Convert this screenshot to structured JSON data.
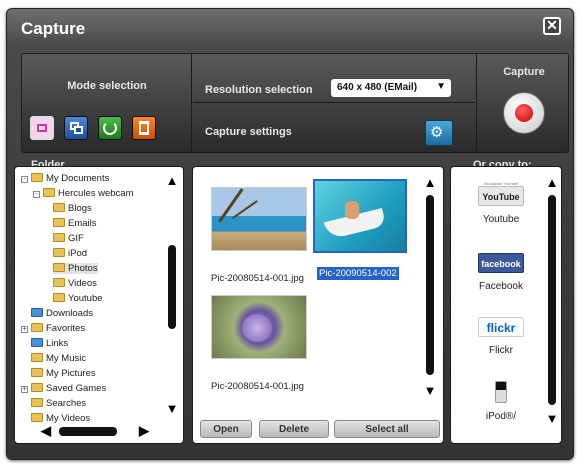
{
  "window": {
    "title": "Capture",
    "close_symbol": "✕"
  },
  "mode_selection": {
    "label": "Mode selection"
  },
  "resolution": {
    "label": "Resolution selection",
    "selected": "640 x 480 (EMail)"
  },
  "capture_settings": {
    "label": "Capture settings"
  },
  "capture": {
    "label": "Capture"
  },
  "folder": {
    "label": "Folder",
    "tree": [
      "My Documents",
      "Hercules webcam",
      "Blogs",
      "Emails",
      "GIF",
      "iPod",
      "Photos",
      "Videos",
      "Youtube",
      "Downloads",
      "Favorites",
      "Links",
      "My Music",
      "My Pictures",
      "Saved Games",
      "Searches",
      "My Videos"
    ]
  },
  "files": [
    {
      "name": "Pic-20080514-001.jpg",
      "selected": false
    },
    {
      "name": "Pic-20090514-002",
      "selected": true
    },
    {
      "name": "Pic-20080514-001.jpg",
      "selected": false
    }
  ],
  "actions": {
    "open": "Open",
    "delete": "Delete",
    "select_all": "Select all"
  },
  "copy_to": {
    "label": "Or copy to:",
    "services": [
      {
        "logo": "YouTube",
        "label": "Youtube"
      },
      {
        "logo": "facebook",
        "label": "Facebook"
      },
      {
        "logo": "flickr",
        "label": "Flickr"
      },
      {
        "logo": "",
        "label": "iPod®/"
      }
    ],
    "youtube_tagline": "Broadcast Yourself"
  }
}
